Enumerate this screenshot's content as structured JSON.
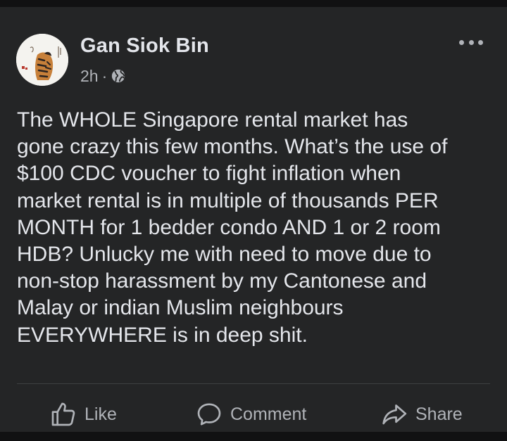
{
  "post": {
    "author": "Gan Siok Bin",
    "time": "2h",
    "separator": "·",
    "audience_icon": "globe-icon",
    "more_icon": "more-options-icon",
    "text": "The WHOLE Singapore rental market has\ngone crazy this few months. What’s the use of\n$100 CDC voucher to fight inflation when\nmarket rental is in multiple of thousands PER\nMONTH for 1 bedder condo AND 1 or 2 room\nHDB? Unlucky me with need to move due to\nnon-stop harassment by my Cantonese and\nMalay or indian Muslim neighbours\nEVERYWHERE is in deep shit."
  },
  "actions": {
    "like": {
      "label": "Like",
      "icon": "thumbs-up-icon"
    },
    "comment": {
      "label": "Comment",
      "icon": "speech-bubble-icon"
    },
    "share": {
      "label": "Share",
      "icon": "share-arrow-icon"
    }
  },
  "colors": {
    "background": "#242526",
    "text_primary": "#e4e6eb",
    "text_secondary": "#b0b3b8",
    "divider": "#3e4042"
  }
}
